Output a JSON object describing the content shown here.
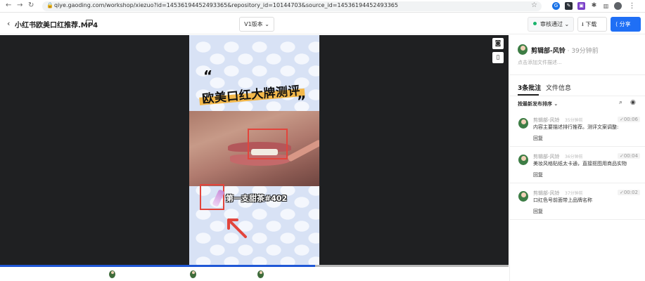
{
  "browser": {
    "url": "qiye.gaoding.com/workshop/xiezuo?id=14536194452493365&repository_id=10144703&source_id=14536194452493365",
    "back_icon": "back-arrow-icon",
    "forward_icon": "forward-arrow-icon",
    "reload_icon": "reload-icon",
    "extension_colors": [
      "#1a73e8",
      "#2b3038",
      "#7a40c8",
      "#555555",
      "#555555"
    ]
  },
  "header": {
    "back_glyph": "‹",
    "file_title": "小红书欧美口红推荐.MP4",
    "version_label": "V1版本 ⌄",
    "audit_label": "审核通过 ⌄",
    "download_label": "⭳ 下载",
    "share_label": "⟨ 分享",
    "share_color": "#1f6ff5"
  },
  "video": {
    "quote_open": "“",
    "quote_close": "”",
    "headline": "欧美口红大牌测评",
    "caption": "第一支甜茶#402",
    "accent_color": "#e2453c",
    "progress_percent": 62
  },
  "panel": {
    "owner_name": "剪辑部-风铃",
    "owner_time": " · 39分钟前",
    "description_placeholder": "点击添加文件描述...",
    "tabs": [
      "3条批注",
      "文件信息"
    ],
    "sort_label": "按最新发布排序 ⌄",
    "comments": [
      {
        "name": "剪辑部-风铃",
        "ago": "35分钟前",
        "text": "内容主要描述排行推荐。测评文案调整:",
        "reply": "回复",
        "stamp": "✓00:06"
      },
      {
        "name": "剪辑部-风铃",
        "ago": "36分钟前",
        "text": "美妆风格贴纸太卡通，直接抠图用商品实物",
        "reply": "回复",
        "stamp": "✓00:04"
      },
      {
        "name": "剪辑部-风铃",
        "ago": "37分钟前",
        "text": "口红色号前面带上品牌名称",
        "reply": "回复",
        "stamp": "✓00:02"
      }
    ]
  }
}
